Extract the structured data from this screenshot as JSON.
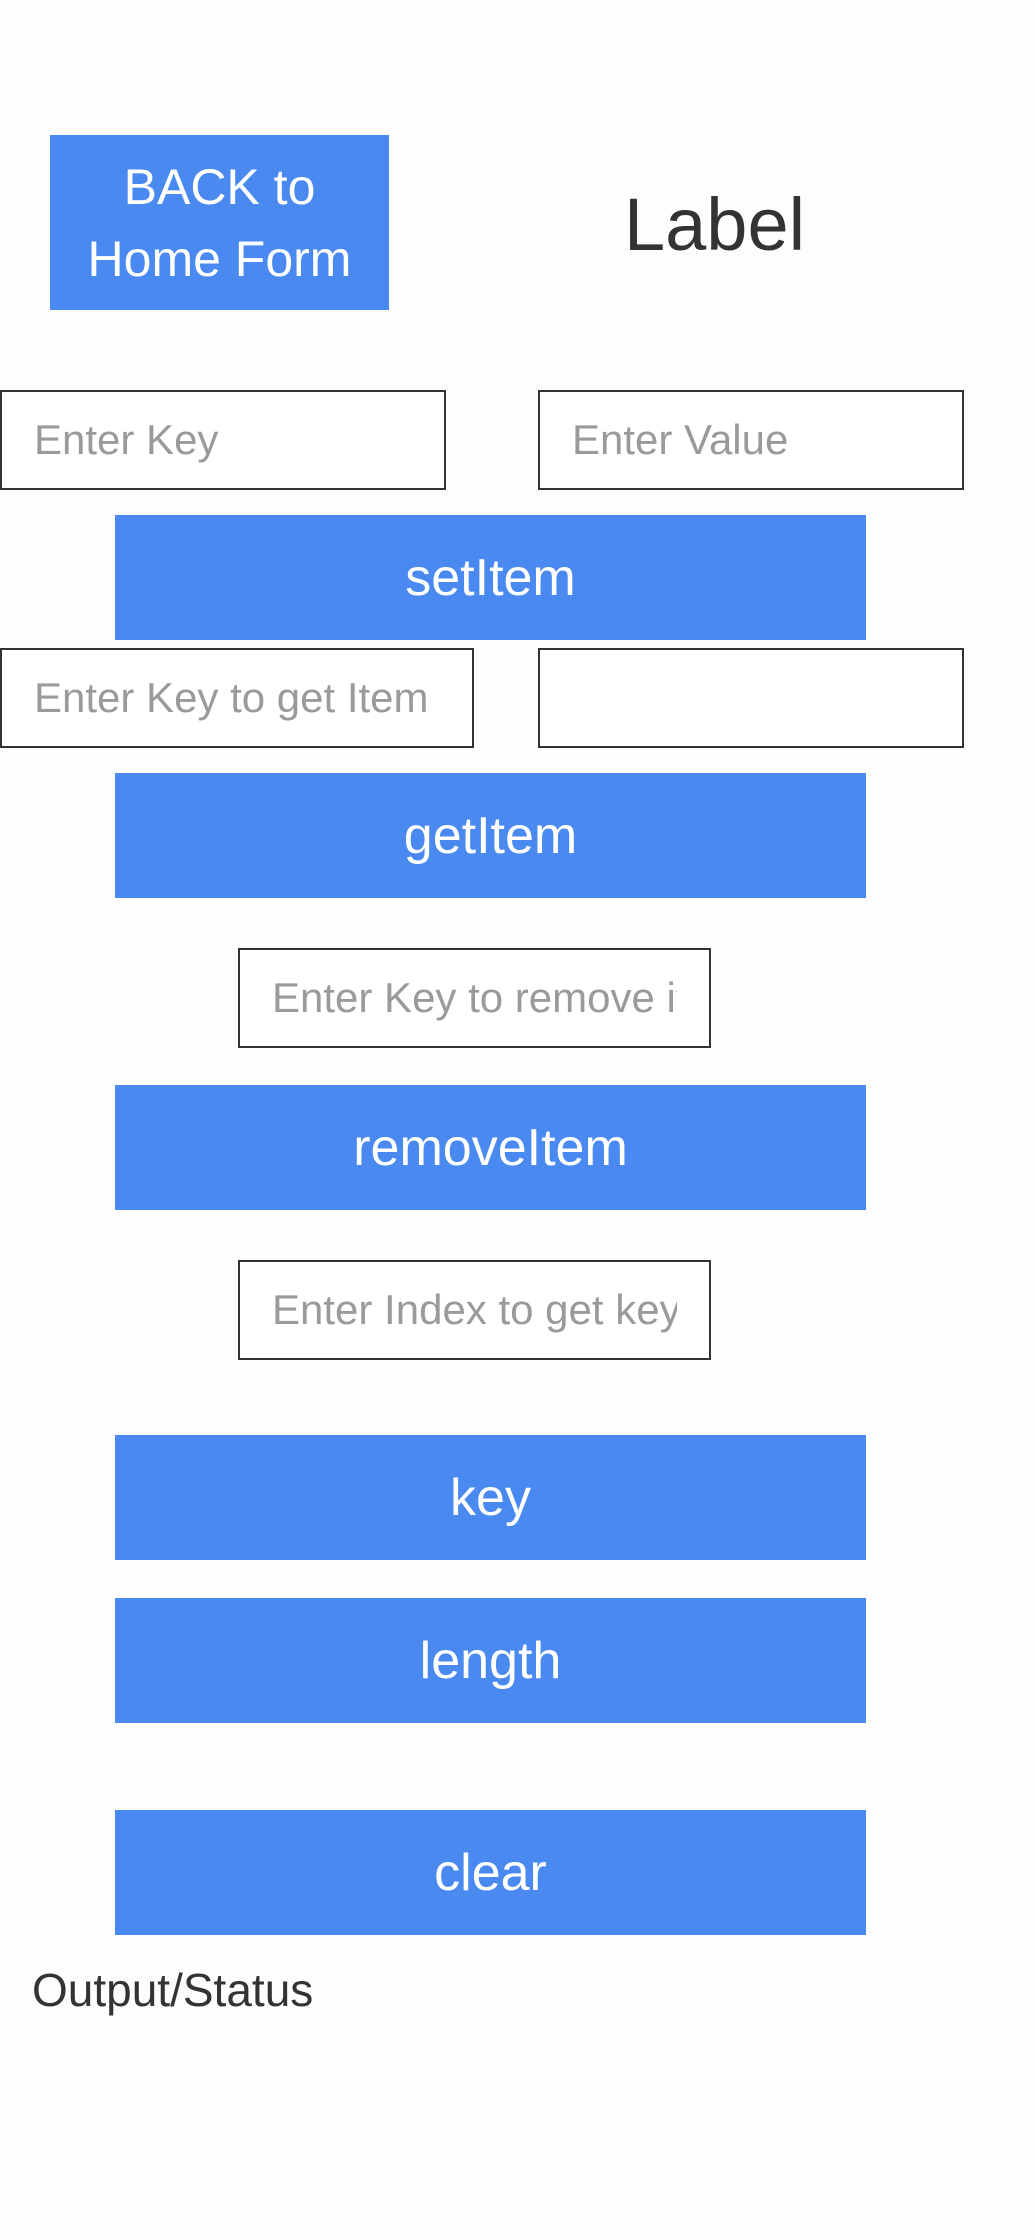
{
  "header": {
    "back_button_label": "BACK to Home Form",
    "title_label": "Label"
  },
  "set_section": {
    "key_placeholder": "Enter Key",
    "value_placeholder": "Enter Value",
    "button_label": "setItem"
  },
  "get_section": {
    "key_placeholder": "Enter Key to get Item",
    "result_value": "",
    "button_label": "getItem"
  },
  "remove_section": {
    "key_placeholder": "Enter Key to remove item",
    "button_label": "removeItem"
  },
  "key_section": {
    "index_placeholder": "Enter Index to get key",
    "button_label": "key"
  },
  "length_section": {
    "button_label": "length"
  },
  "clear_section": {
    "button_label": "clear"
  },
  "output": {
    "status_text": "Output/Status"
  },
  "colors": {
    "accent": "#4a89ef",
    "background": "#fdfdfd",
    "field_border": "#333333",
    "placeholder": "#9a9a9a"
  }
}
